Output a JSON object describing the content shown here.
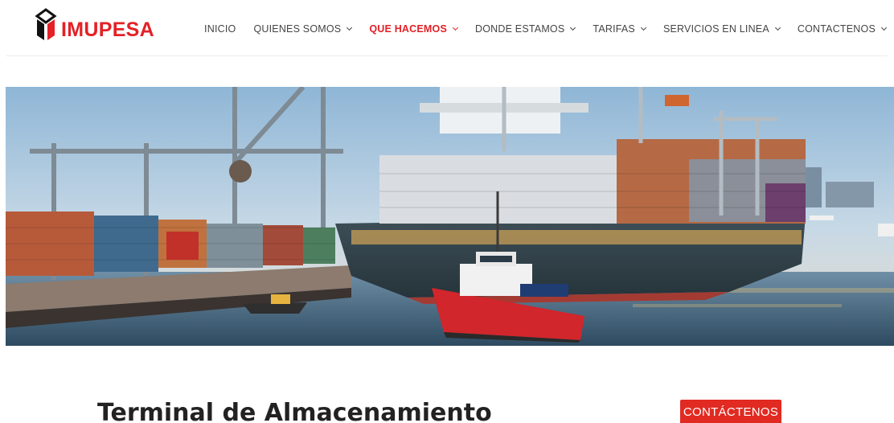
{
  "brand": {
    "name": "IMUPESA",
    "color": "#e32126",
    "logo_icon": "imupesa-logo-icon"
  },
  "nav": {
    "items": [
      {
        "label": "INICIO",
        "has_dropdown": false,
        "active": false
      },
      {
        "label": "QUIENES SOMOS",
        "has_dropdown": true,
        "active": false
      },
      {
        "label": "QUE HACEMOS",
        "has_dropdown": true,
        "active": true
      },
      {
        "label": "DONDE ESTAMOS",
        "has_dropdown": true,
        "active": false
      },
      {
        "label": "TARIFAS",
        "has_dropdown": true,
        "active": false
      },
      {
        "label": "SERVICIOS EN LINEA",
        "has_dropdown": true,
        "active": false
      },
      {
        "label": "CONTACTENOS",
        "has_dropdown": true,
        "active": false
      }
    ],
    "dropdown_icon": "chevron-down-icon",
    "text_color": "#444444",
    "active_color": "#e32126"
  },
  "hero": {
    "image": "port-container-ship-photo"
  },
  "content": {
    "title": "Terminal de Almacenamiento",
    "cta_label": "CONTÁCTENOS",
    "cta_color": "#e12a22"
  }
}
